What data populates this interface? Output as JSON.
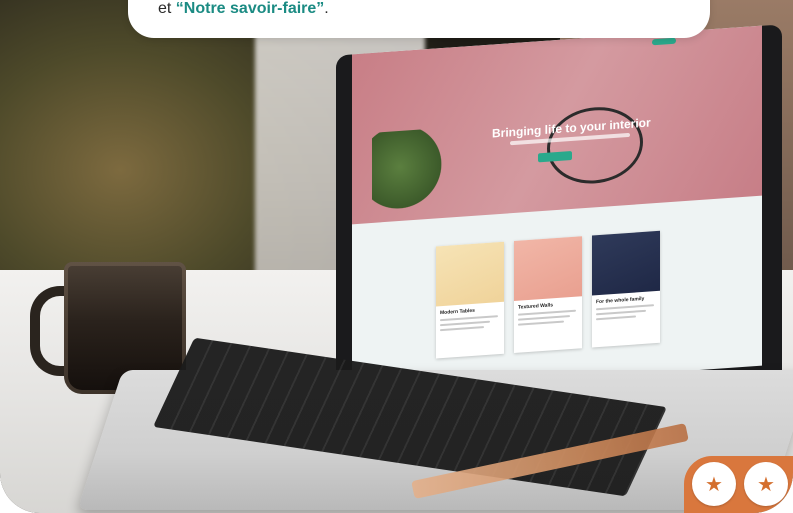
{
  "top_card": {
    "prefix": "et ",
    "link_text": "“Notre savoir-faire”",
    "suffix": "."
  },
  "screen": {
    "hero_title": "Bringing life to your interior",
    "cards": [
      {
        "title": "Modern Tables"
      },
      {
        "title": "Textured Walls"
      },
      {
        "title": "For the whole family"
      }
    ]
  },
  "badges": [
    {
      "icon": "star-icon"
    },
    {
      "icon": "star-icon"
    }
  ],
  "colors": {
    "accent_teal": "#1b8b83",
    "badge_orange": "#d9773d"
  }
}
